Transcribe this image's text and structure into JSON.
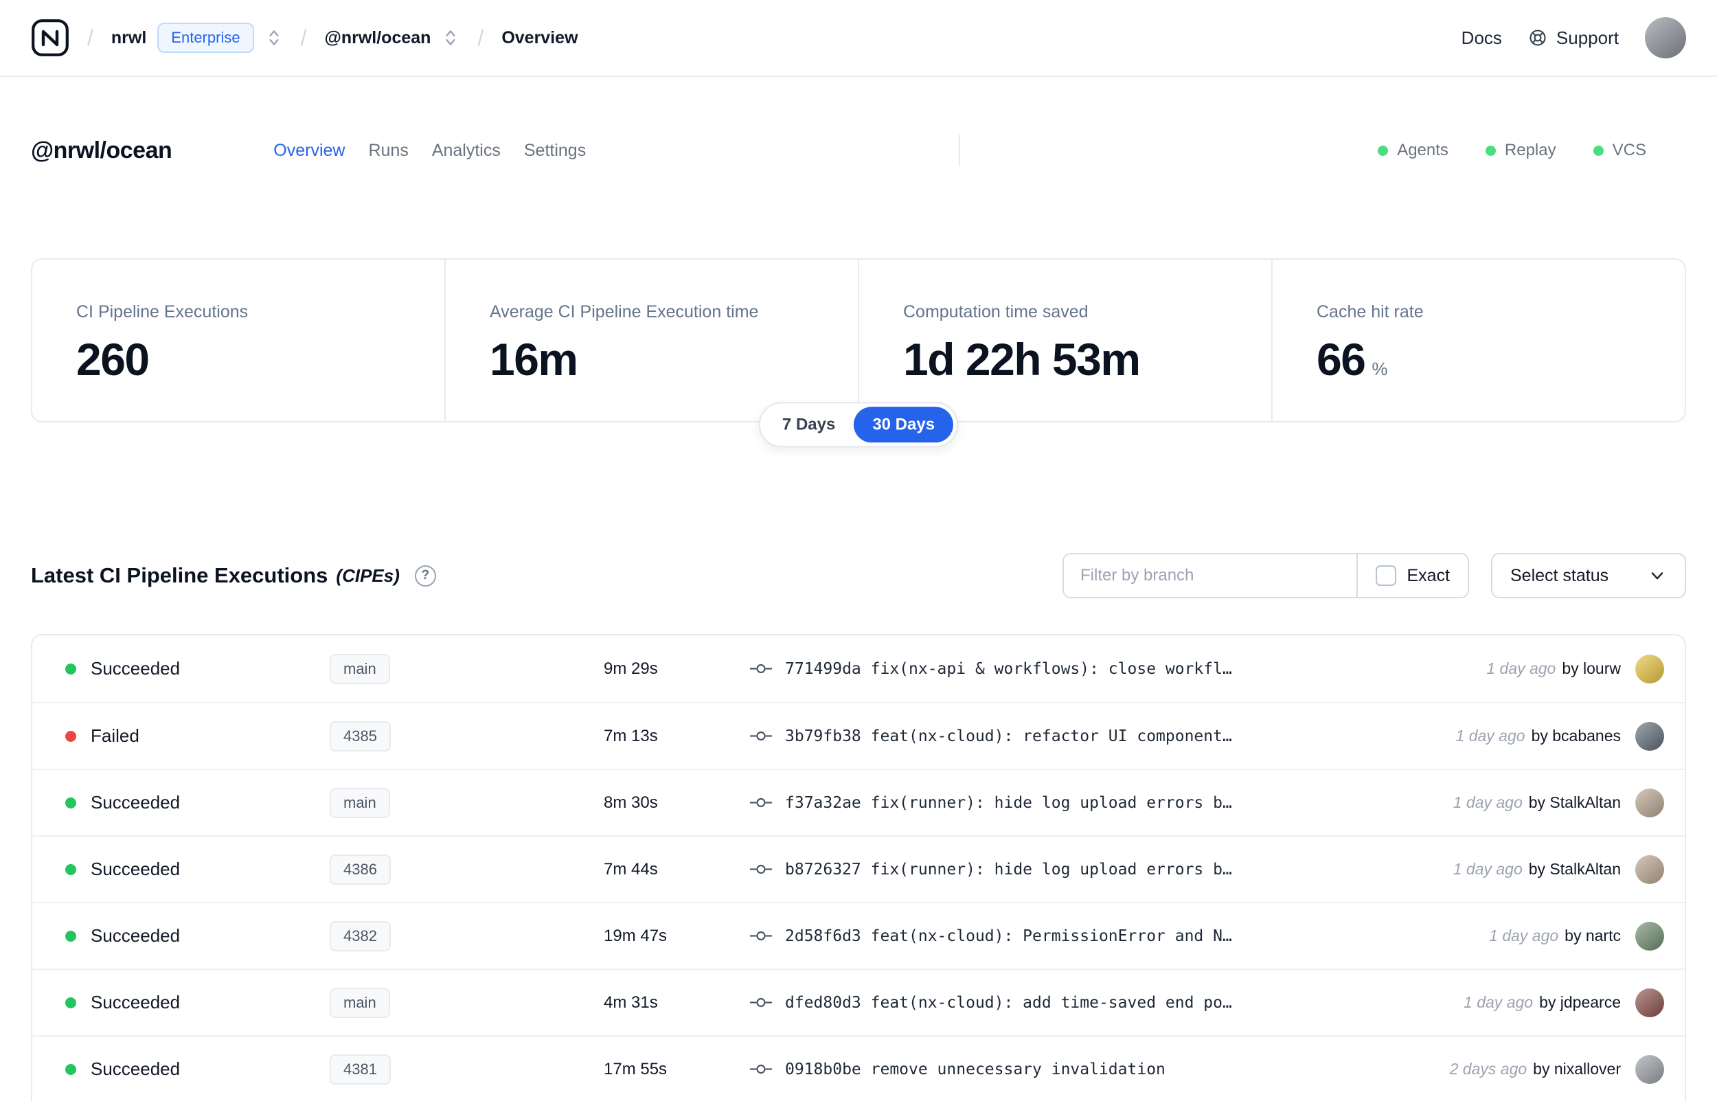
{
  "navbar": {
    "breadcrumb_separator": "/",
    "org_name": "nrwl",
    "org_badge": "Enterprise",
    "workspace_name": "@nrwl/ocean",
    "page_name": "Overview",
    "docs_label": "Docs",
    "support_label": "Support",
    "user_avatar_color": "#8a8f98"
  },
  "header": {
    "title": "@nrwl/ocean",
    "tabs": [
      {
        "label": "Overview",
        "active": true
      },
      {
        "label": "Runs",
        "active": false
      },
      {
        "label": "Analytics",
        "active": false
      },
      {
        "label": "Settings",
        "active": false
      }
    ],
    "indicators": [
      {
        "label": "Agents",
        "color": "#4ade80"
      },
      {
        "label": "Replay",
        "color": "#4ade80"
      },
      {
        "label": "VCS",
        "color": "#4ade80"
      }
    ]
  },
  "stats": {
    "cards": [
      {
        "label": "CI Pipeline Executions",
        "value": "260",
        "suffix": ""
      },
      {
        "label": "Average CI Pipeline Execution time",
        "value": "16m",
        "suffix": ""
      },
      {
        "label": "Computation time saved",
        "value": "1d 22h 53m",
        "suffix": ""
      },
      {
        "label": "Cache hit rate",
        "value": "66",
        "suffix": "%"
      }
    ],
    "range_options": [
      {
        "label": "7 Days",
        "active": false
      },
      {
        "label": "30 Days",
        "active": true
      }
    ]
  },
  "cipes": {
    "title": "Latest CI Pipeline Executions",
    "title_note": "(CIPEs)",
    "help_icon": "?",
    "filter_placeholder": "Filter by branch",
    "exact_label": "Exact",
    "status_button_label": "Select status",
    "rows": [
      {
        "status": "Succeeded",
        "status_color": "#22c55e",
        "branch": "main",
        "duration": "9m 29s",
        "commit": "771499da fix(nx-api & workflows): close workfl…",
        "time": "1 day ago",
        "author": "by lourw",
        "avatar_color": "#e7c33c"
      },
      {
        "status": "Failed",
        "status_color": "#ef4444",
        "branch": "4385",
        "duration": "7m 13s",
        "commit": "3b79fb38 feat(nx-cloud): refactor UI component…",
        "time": "1 day ago",
        "author": "by bcabanes",
        "avatar_color": "#5f6b76"
      },
      {
        "status": "Succeeded",
        "status_color": "#22c55e",
        "branch": "main",
        "duration": "8m 30s",
        "commit": "f37a32ae fix(runner): hide log upload errors b…",
        "time": "1 day ago",
        "author": "by StalkAltan",
        "avatar_color": "#b9a58f"
      },
      {
        "status": "Succeeded",
        "status_color": "#22c55e",
        "branch": "4386",
        "duration": "7m 44s",
        "commit": "b8726327 fix(runner): hide log upload errors b…",
        "time": "1 day ago",
        "author": "by StalkAltan",
        "avatar_color": "#b9a58f"
      },
      {
        "status": "Succeeded",
        "status_color": "#22c55e",
        "branch": "4382",
        "duration": "19m 47s",
        "commit": "2d58f6d3 feat(nx-cloud): PermissionError and N…",
        "time": "1 day ago",
        "author": "by nartc",
        "avatar_color": "#6f8b6e"
      },
      {
        "status": "Succeeded",
        "status_color": "#22c55e",
        "branch": "main",
        "duration": "4m 31s",
        "commit": "dfed80d3 feat(nx-cloud): add time-saved end po…",
        "time": "1 day ago",
        "author": "by jdpearce",
        "avatar_color": "#8b4f4a"
      },
      {
        "status": "Succeeded",
        "status_color": "#22c55e",
        "branch": "4381",
        "duration": "17m 55s",
        "commit": "0918b0be remove unnecessary invalidation",
        "time": "2 days ago",
        "author": "by nixallover",
        "avatar_color": "#9aa0a6"
      }
    ]
  },
  "colors": {
    "accent": "#2563eb",
    "success": "#22c55e",
    "danger": "#ef4444"
  }
}
